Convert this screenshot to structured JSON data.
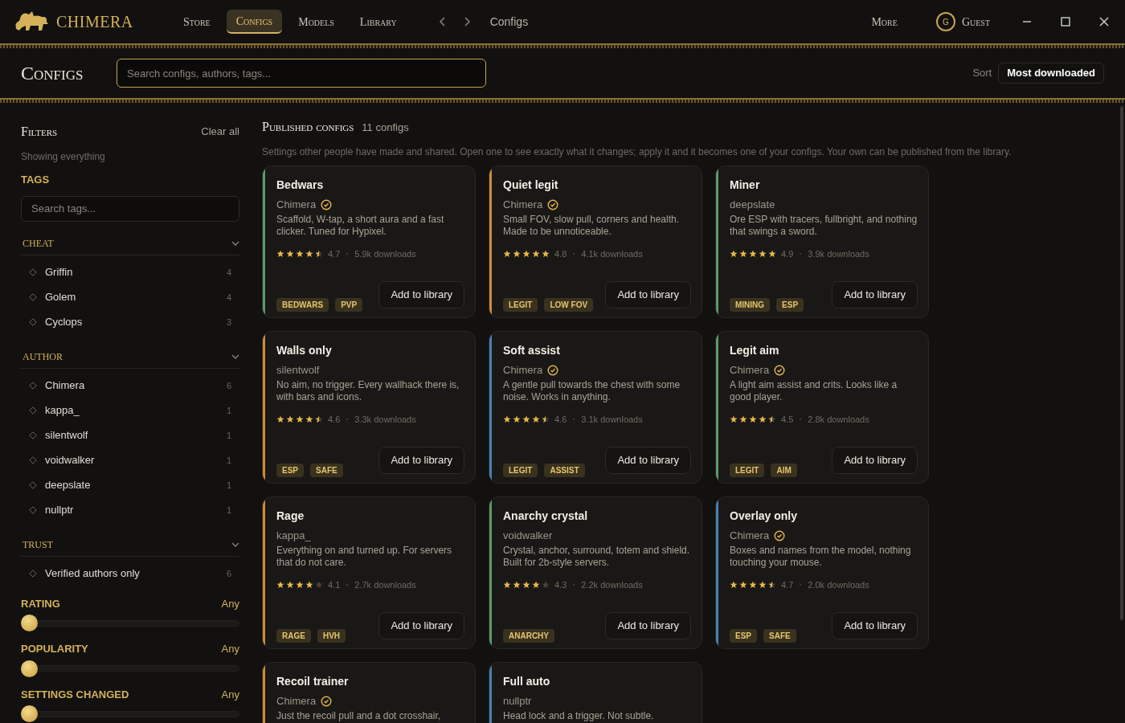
{
  "app": {
    "brand": "CHIMERA",
    "nav": [
      {
        "label": "Store",
        "selected": false
      },
      {
        "label": "Configs",
        "selected": true
      },
      {
        "label": "Models",
        "selected": false
      },
      {
        "label": "Library",
        "selected": false
      }
    ],
    "breadcrumb": "Configs",
    "more": "More",
    "avatar_letter": "G",
    "user": "Guest"
  },
  "header": {
    "title": "Configs",
    "search": {
      "placeholder": "Search configs, authors, tags..."
    },
    "sort_label": "Sort",
    "sort_value": "Most downloaded"
  },
  "filters": {
    "title": "Filters",
    "clear": "Clear all",
    "summary": "Showing everything",
    "tags_heading": "TAGS",
    "tag_search": {
      "placeholder": "Search tags..."
    },
    "groups": [
      {
        "title": "CHEAT",
        "expanded": true,
        "items": [
          {
            "label": "Griffin",
            "count": "4",
            "checked": false
          },
          {
            "label": "Golem",
            "count": "4",
            "checked": false
          },
          {
            "label": "Cyclops",
            "count": "3",
            "checked": false
          }
        ]
      },
      {
        "title": "AUTHOR",
        "expanded": true,
        "items": [
          {
            "label": "Chimera",
            "count": "6",
            "checked": false
          },
          {
            "label": "kappa_",
            "count": "1",
            "checked": false
          },
          {
            "label": "silentwolf",
            "count": "1",
            "checked": false
          },
          {
            "label": "voidwalker",
            "count": "1",
            "checked": false
          },
          {
            "label": "deepslate",
            "count": "1",
            "checked": false
          },
          {
            "label": "nullptr",
            "count": "1",
            "checked": false
          }
        ]
      },
      {
        "title": "TRUST",
        "expanded": true,
        "items": [
          {
            "label": "Verified authors only",
            "count": "6",
            "checked": false
          }
        ]
      }
    ],
    "sliders": [
      {
        "label": "RATING",
        "value": "Any",
        "level": 0
      },
      {
        "label": "POPULARITY",
        "value": "Any",
        "level": 0
      },
      {
        "label": "SETTINGS CHANGED",
        "value": "Any",
        "level": 0
      }
    ]
  },
  "published": {
    "title": "Published configs",
    "count": "11 configs",
    "intro": "Settings other people have made and shared. Open one to see exactly what it changes; apply it and it becomes one of your configs. Your own can be published from the library.",
    "cards": [
      {
        "name": "Bedwars",
        "author": "Chimera",
        "verified": true,
        "description": "Scaffold, W-tap, a short aura and a fast clicker. Tuned for Hypixel.",
        "stars": 4.5,
        "rating": "4.7",
        "downloads": "5.9k downloads",
        "tags": [
          "BEDWARS",
          "PVP"
        ],
        "action": "Add to library",
        "color": "#5a9a6a"
      },
      {
        "name": "Quiet legit",
        "author": "Chimera",
        "verified": true,
        "description": "Small FOV, slow pull, corners and health. Made to be unnoticeable.",
        "stars": 5,
        "rating": "4.8",
        "downloads": "4.1k downloads",
        "tags": [
          "LEGIT",
          "LOW FOV"
        ],
        "action": "Add to library",
        "color": "#d08a3a"
      },
      {
        "name": "Miner",
        "author": "deepslate",
        "verified": false,
        "description": "Ore ESP with tracers, fullbright, and nothing that swings a sword.",
        "stars": 5,
        "rating": "4.9",
        "downloads": "3.9k downloads",
        "tags": [
          "MINING",
          "ESP"
        ],
        "action": "Add to library",
        "color": "#5a9a6a"
      },
      {
        "name": "Walls only",
        "author": "silentwolf",
        "verified": false,
        "description": "No aim, no trigger. Every wallhack there is, with bars and icons.",
        "stars": 4.5,
        "rating": "4.6",
        "downloads": "3.3k downloads",
        "tags": [
          "ESP",
          "SAFE"
        ],
        "action": "Add to library",
        "color": "#d08a3a"
      },
      {
        "name": "Soft assist",
        "author": "Chimera",
        "verified": true,
        "description": "A gentle pull towards the chest with some noise. Works in anything.",
        "stars": 4.5,
        "rating": "4.6",
        "downloads": "3.1k downloads",
        "tags": [
          "LEGIT",
          "ASSIST"
        ],
        "action": "Add to library",
        "color": "#4a7fb8"
      },
      {
        "name": "Legit aim",
        "author": "Chimera",
        "verified": true,
        "description": "A light aim assist and crits. Looks like a good player.",
        "stars": 4.5,
        "rating": "4.5",
        "downloads": "2.8k downloads",
        "tags": [
          "LEGIT",
          "AIM"
        ],
        "action": "Add to library",
        "color": "#5a9a6a"
      },
      {
        "name": "Rage",
        "author": "kappa_",
        "verified": false,
        "description": "Everything on and turned up. For servers that do not care.",
        "stars": 4,
        "rating": "4.1",
        "downloads": "2.7k downloads",
        "tags": [
          "RAGE",
          "HVH"
        ],
        "action": "Add to library",
        "color": "#d08a3a"
      },
      {
        "name": "Anarchy crystal",
        "author": "voidwalker",
        "verified": false,
        "description": "Crystal, anchor, surround, totem and shield. Built for 2b-style servers.",
        "stars": 4,
        "rating": "4.3",
        "downloads": "2.2k downloads",
        "tags": [
          "ANARCHY"
        ],
        "action": "Add to library",
        "color": "#5a9a6a"
      },
      {
        "name": "Overlay only",
        "author": "Chimera",
        "verified": true,
        "description": "Boxes and names from the model, nothing touching your mouse.",
        "stars": 4.5,
        "rating": "4.7",
        "downloads": "2.0k downloads",
        "tags": [
          "ESP",
          "SAFE"
        ],
        "action": "Add to library",
        "color": "#4a7fb8"
      },
      {
        "name": "Recoil trainer",
        "author": "Chimera",
        "verified": true,
        "description": "Just the recoil pull and a dot crosshair,",
        "color": "#d08a3a"
      },
      {
        "name": "Full auto",
        "author": "nullptr",
        "verified": false,
        "description": "Head lock and a trigger. Not subtle.",
        "color": "#4a7fb8"
      }
    ]
  }
}
